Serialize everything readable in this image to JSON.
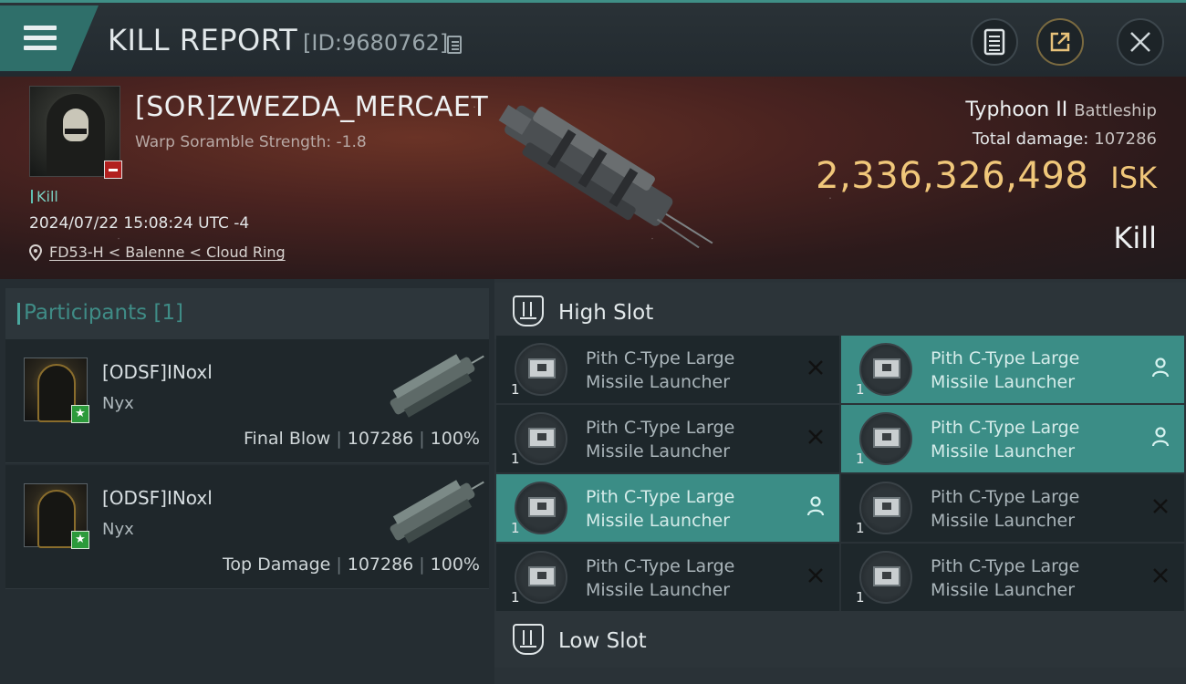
{
  "header": {
    "title": "KILL REPORT",
    "report_id": "[ID:9680762]"
  },
  "victim": {
    "name": "[SOR]ZWEZDA_MERCAET",
    "warp_scramble": "Warp Soramble Strength: -1.8",
    "tag": "Kill",
    "datetime": "2024/07/22 15:08:24 UTC -4",
    "location": "FD53-H < Balenne < Cloud Ring",
    "ship": "Typhoon II",
    "ship_class": "Battleship",
    "total_damage_label": "Total damage:",
    "total_damage": "107286",
    "isk_value": "2,336,326,498",
    "isk_unit": "ISK",
    "result": "Kill"
  },
  "participants": {
    "title": "Participants",
    "count": "[1]",
    "rows": [
      {
        "name": "[ODSF]INoxl",
        "ship": "Nyx",
        "role": "Final Blow",
        "damage": "107286",
        "percent": "100%"
      },
      {
        "name": "[ODSF]INoxl",
        "ship": "Nyx",
        "role": "Top Damage",
        "damage": "107286",
        "percent": "100%"
      }
    ]
  },
  "slots": {
    "high_label": "High Slot",
    "low_label": "Low Slot",
    "high": [
      {
        "line1": "Pith C-Type Large",
        "line2": "Missile Launcher",
        "qty": "1",
        "status": "destroyed"
      },
      {
        "line1": "Pith C-Type Large",
        "line2": "Missile Launcher",
        "qty": "1",
        "status": "dropped"
      },
      {
        "line1": "Pith C-Type Large",
        "line2": "Missile Launcher",
        "qty": "1",
        "status": "destroyed"
      },
      {
        "line1": "Pith C-Type Large",
        "line2": "Missile Launcher",
        "qty": "1",
        "status": "dropped"
      },
      {
        "line1": "Pith C-Type Large",
        "line2": "Missile Launcher",
        "qty": "1",
        "status": "dropped"
      },
      {
        "line1": "Pith C-Type Large",
        "line2": "Missile Launcher",
        "qty": "1",
        "status": "destroyed"
      },
      {
        "line1": "Pith C-Type Large",
        "line2": "Missile Launcher",
        "qty": "1",
        "status": "destroyed"
      },
      {
        "line1": "Pith C-Type Large",
        "line2": "Missile Launcher",
        "qty": "1",
        "status": "destroyed"
      }
    ]
  },
  "colors": {
    "accent": "#3b8d86",
    "isk": "#f0c77a",
    "loss_badge": "#b2201f",
    "ally_badge": "#2c9a3b"
  },
  "icons": {
    "menu": "menu-icon",
    "copy": "copy-icon",
    "report": "document-icon",
    "share": "share-icon",
    "close": "close-icon",
    "location": "location-pin-icon",
    "slot": "high-slot-icon",
    "dropped": "person-icon",
    "destroyed": "x-icon"
  }
}
